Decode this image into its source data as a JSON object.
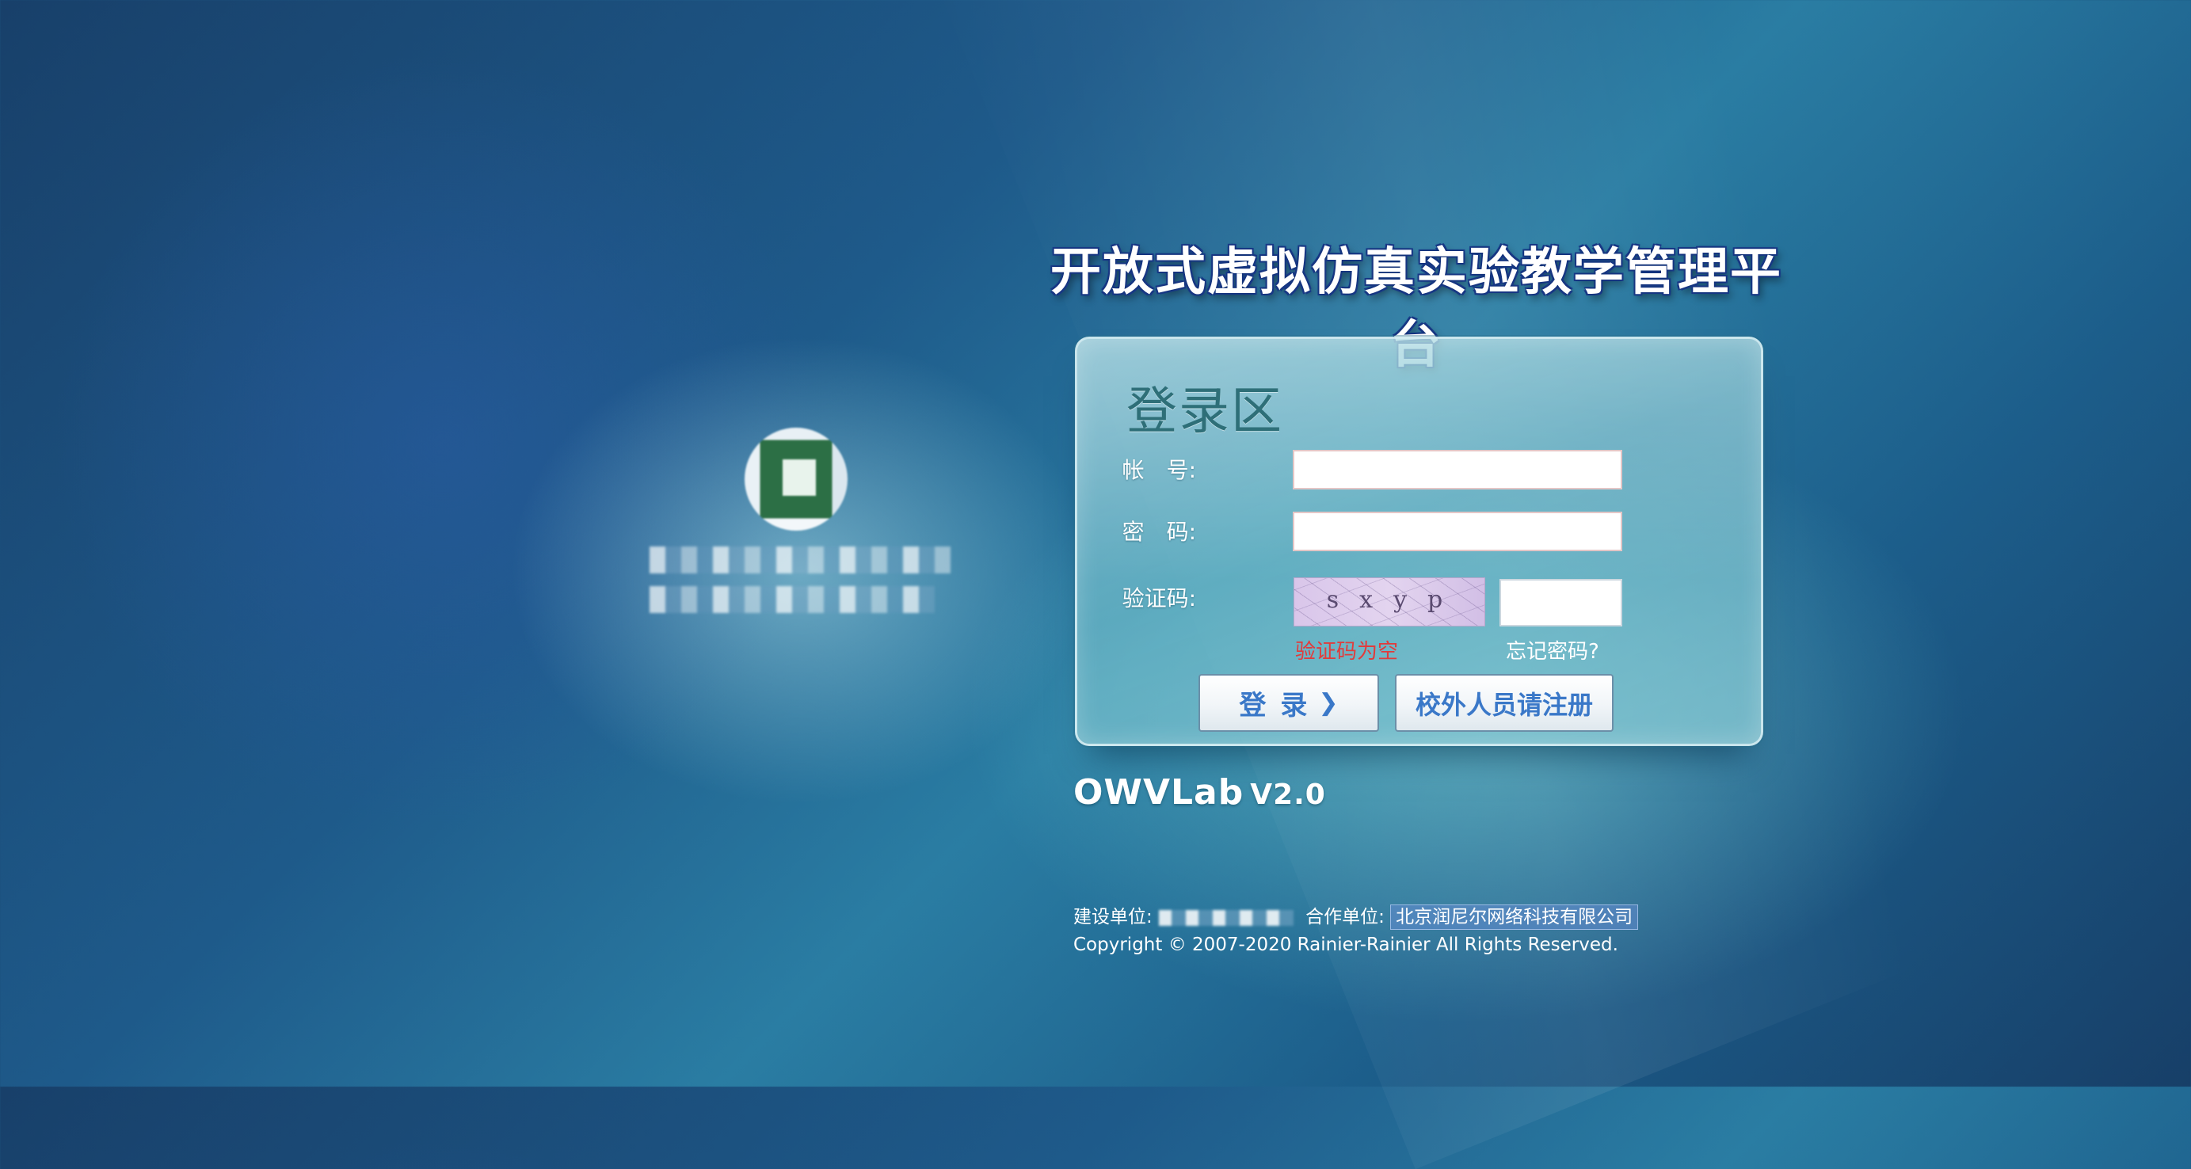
{
  "platform": {
    "title": "开放式虚拟仿真实验教学管理平台"
  },
  "login": {
    "heading": "登录区",
    "account_label": "帐　号:",
    "password_label": "密　码:",
    "captcha_label": "验证码:",
    "captcha_image_text": "sxyp",
    "captcha_error": "验证码为空",
    "forgot_password": "忘记密码?",
    "login_button": "登录",
    "register_button": "校外人员请注册",
    "account_value": "",
    "password_value": "",
    "captcha_value": ""
  },
  "brand": {
    "name": "OWVLab",
    "version": "V2.0"
  },
  "footer": {
    "builder_label": "建设单位:",
    "partner_label": "合作单位:",
    "partner_name": "北京润尼尔网络科技有限公司",
    "copyright": "Copyright © 2007-2020 Rainier-Rainier All Rights Reserved."
  },
  "icons": {
    "login_arrow": "chevron-right-icon"
  }
}
